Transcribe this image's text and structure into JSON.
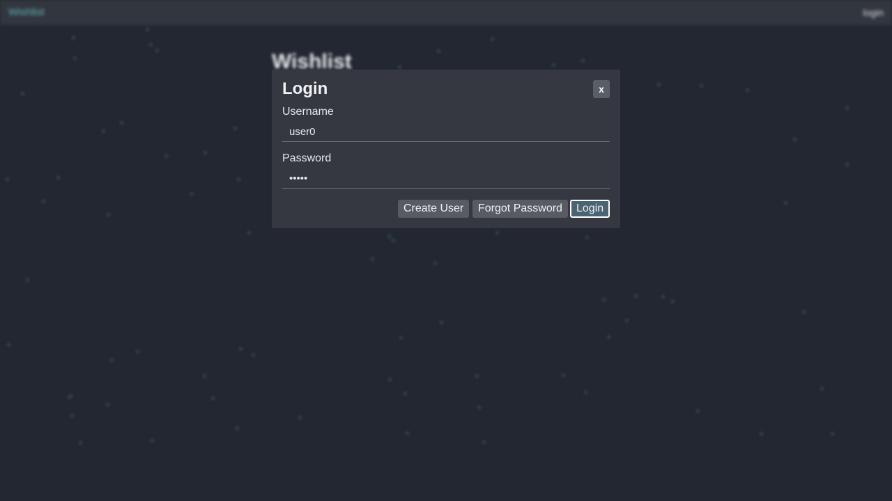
{
  "navbar": {
    "home_label": "Wishlist",
    "login_label": "login"
  },
  "background": {
    "title": "Wishlist"
  },
  "login_modal": {
    "title": "Login",
    "close_label": "x",
    "username_label": "Username",
    "username_value": "user0",
    "password_label": "Password",
    "password_value": "•••••",
    "create_user_label": "Create User",
    "forgot_password_label": "Forgot Password",
    "login_label": "Login"
  },
  "colors": {
    "page_background": "#222731",
    "navbar_background": "#32363f",
    "modal_background": "#353841",
    "link_accent": "#5fb3b3",
    "primary_button": "#4a6473",
    "secondary_button": "#575b63"
  }
}
